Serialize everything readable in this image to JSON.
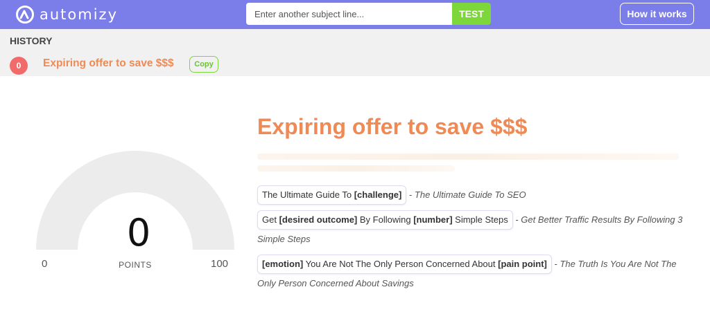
{
  "header": {
    "brand": "automizy",
    "search_placeholder": "Enter another subject line...",
    "test_label": "TEST",
    "how_label": "How it works",
    "colors": {
      "bar": "#7b7de8",
      "accent_green": "#7dd63a"
    }
  },
  "history": {
    "label": "HISTORY",
    "items": [
      {
        "score": "0",
        "subject": "Expiring offer to save $$$",
        "copy_label": "Copy"
      }
    ]
  },
  "gauge": {
    "value": "0",
    "unit": "POINTS",
    "min": "0",
    "max": "100",
    "fraction": 0
  },
  "main": {
    "title": "Expiring offer to save $$$",
    "title_color": "#f08a55",
    "tips": [
      {
        "parts": [
          "The Ultimate Guide To ",
          "[challenge]"
        ],
        "separator": " - ",
        "example": "The Ultimate Guide To SEO"
      },
      {
        "parts": [
          "Get ",
          "[desired outcome]",
          " By Following ",
          "[number]",
          " Simple Steps"
        ],
        "separator": " - ",
        "example": "Get Better Traffic Results By Following 3 Simple Steps"
      },
      {
        "parts": [
          "[emotion]",
          " You Are Not The Only Person Concerned About ",
          "[pain point]"
        ],
        "separator": " - ",
        "example": "The Truth Is You Are Not The Only Person Concerned About Savings"
      }
    ]
  }
}
